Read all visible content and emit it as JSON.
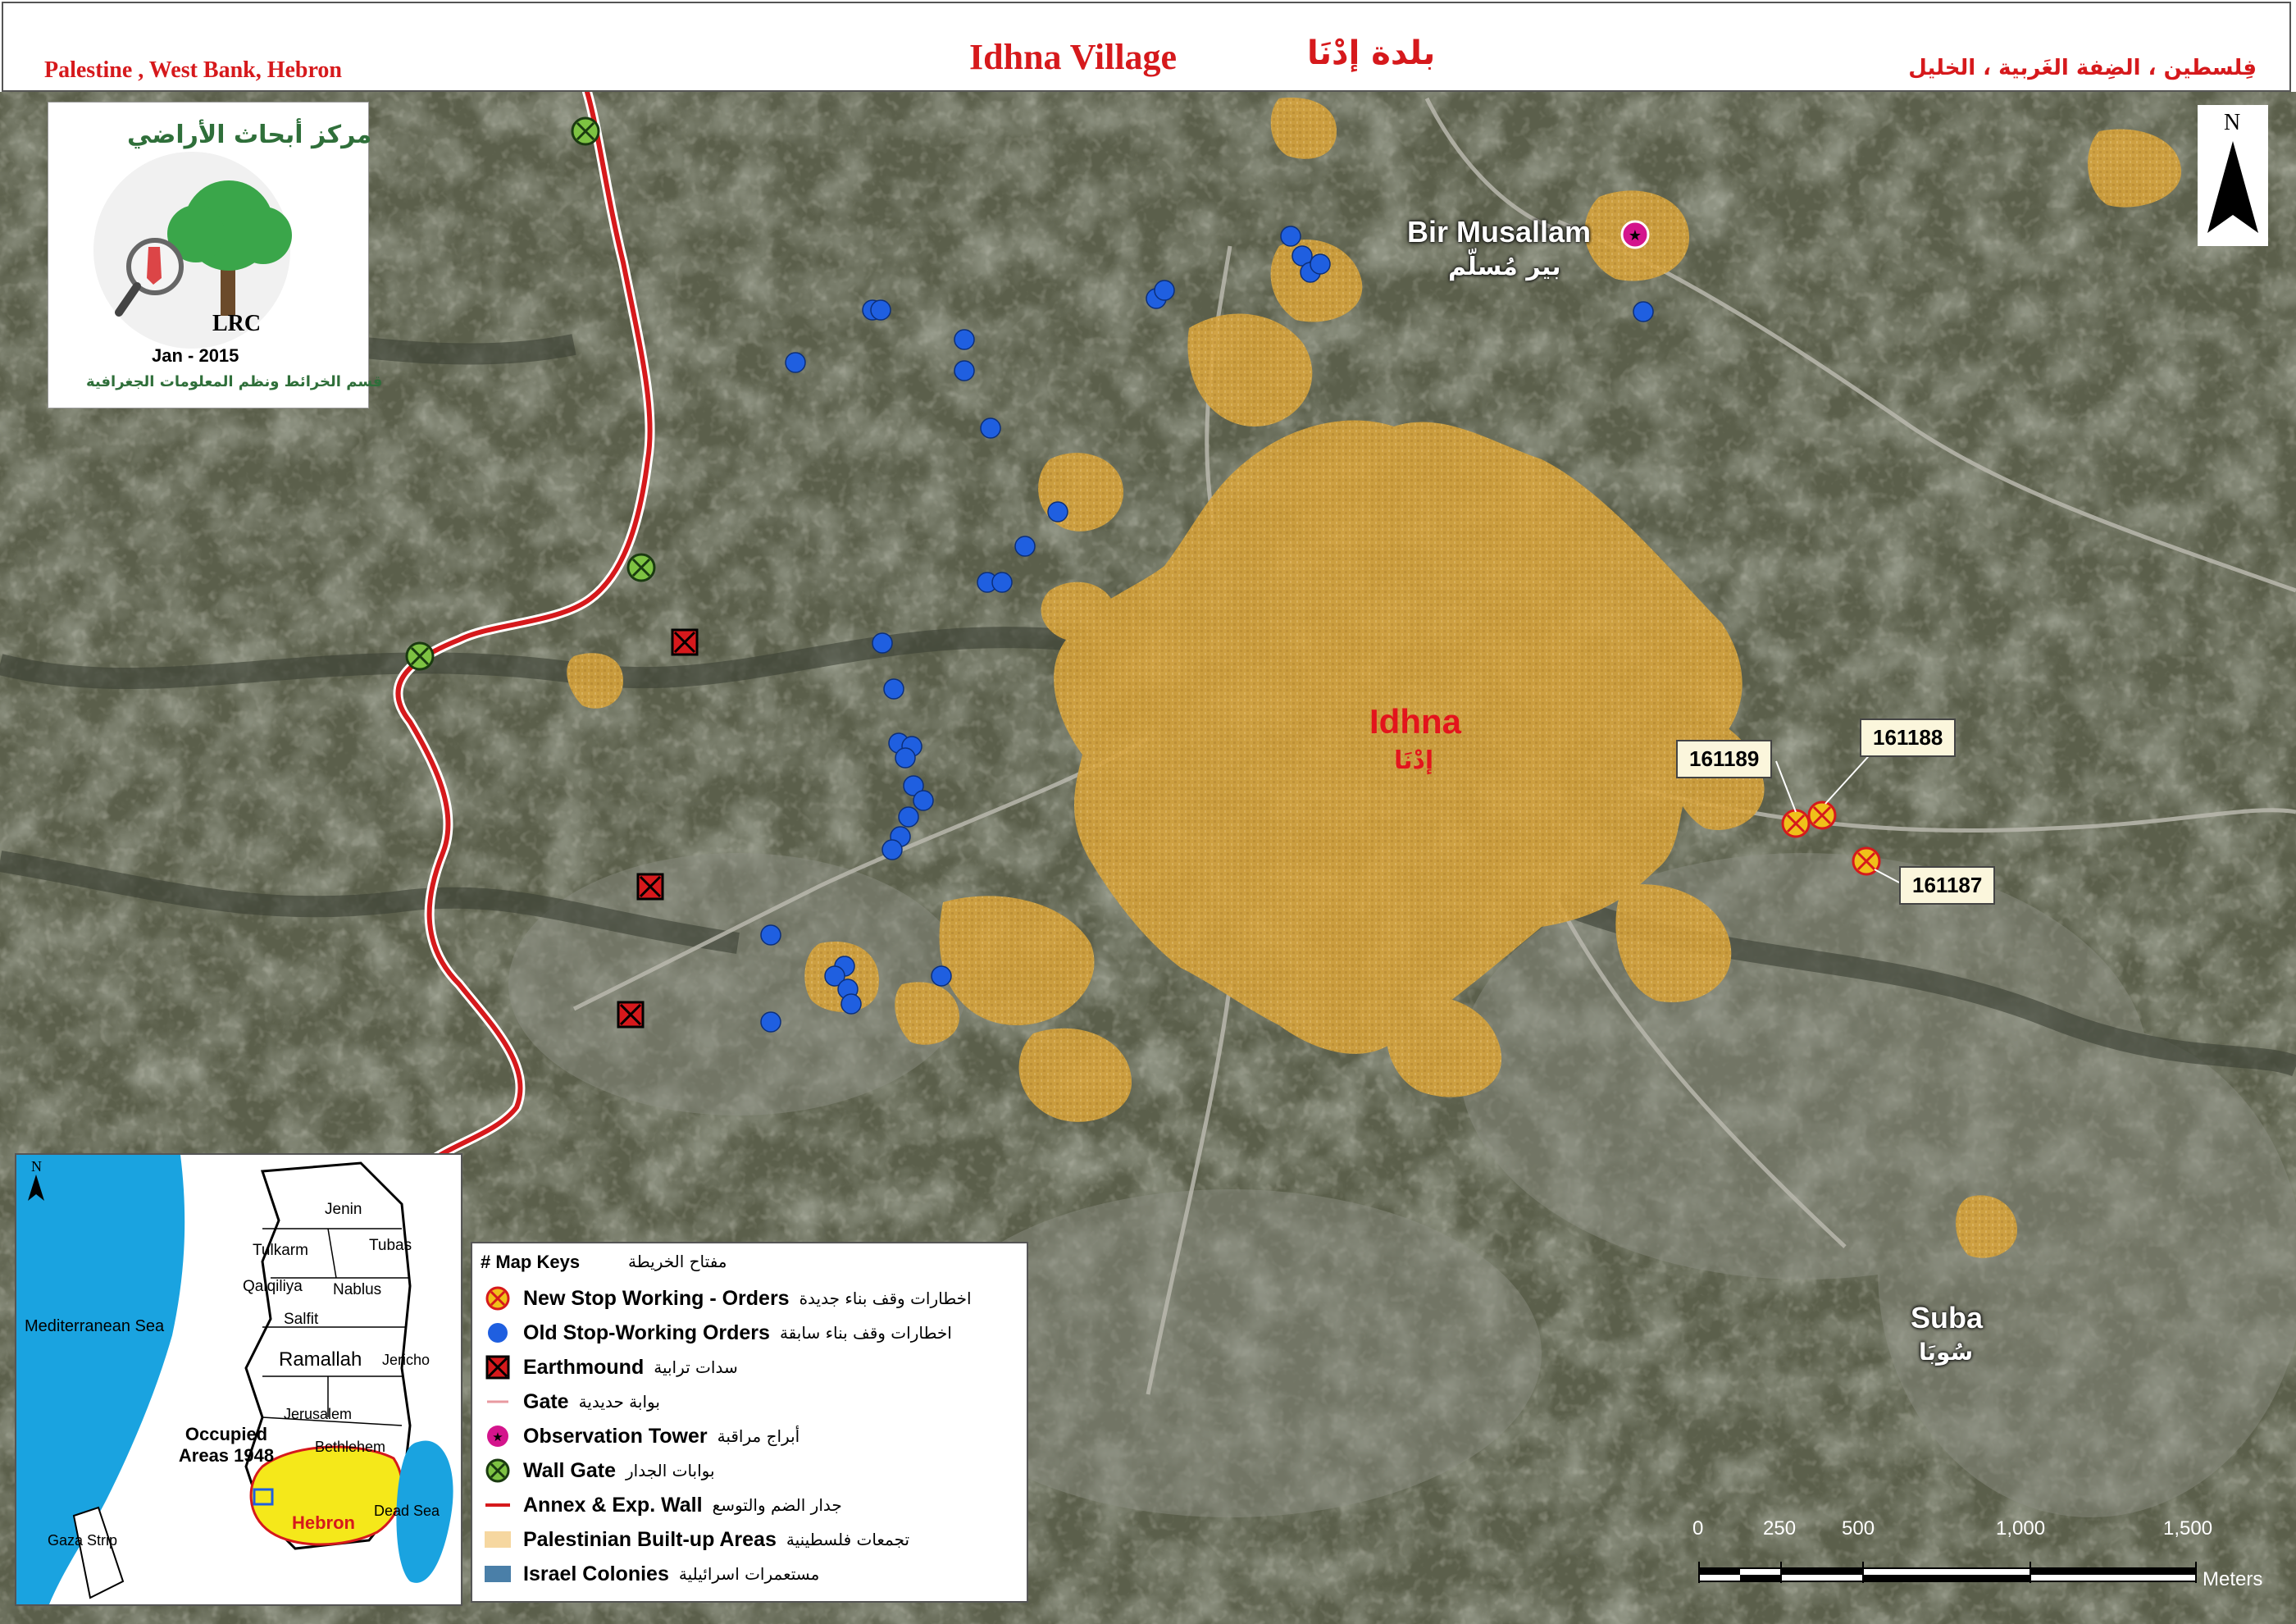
{
  "header": {
    "left": "Palestine , West Bank, Hebron",
    "title_en": "Idhna Village",
    "title_ar": "بلدة إدْنَا",
    "right_ar": "فِلسطين ، الضِفة الغَربية ، الخليل"
  },
  "logo": {
    "arc_text_ar": "مركز أبحاث الأراضي",
    "org": "LRC",
    "date": "Jan - 2015",
    "dept_ar": "قسم الخرائط ونظم المعلومات الجغرافية"
  },
  "places": {
    "idhna_en": "Idhna",
    "idhna_ar": "إدْنَا",
    "bir_en": "Bir Musallam",
    "bir_ar": "بير مُسلّم",
    "suba_en": "Suba",
    "suba_ar": "سُوبَا"
  },
  "callouts": [
    "161189",
    "161188",
    "161187"
  ],
  "north": "N",
  "inset": {
    "north": "N",
    "sea": "Mediterranean Sea",
    "dead_sea": "Dead Sea",
    "gaza": "Gaza Strip",
    "occupied": "Occupied Areas 1948",
    "hebron": "Hebron",
    "jenin": "Jenin",
    "tubas": "Tubas",
    "tulkarm": "Tulkarm",
    "qalqiliya": "Qalqiliya",
    "nablus": "Nablus",
    "salfit": "Salfit",
    "ramallah": "Ramallah",
    "jericho": "Jericho",
    "jerusalem": "Jerusalem",
    "bethlehem": "Bethlehem"
  },
  "legend": {
    "title_en": "# Map Keys",
    "title_ar": "مفتاح الخريطة",
    "items": [
      {
        "en": "New Stop Working - Orders",
        "ar": "اخطارات وقف بناء جديدة",
        "symbol": "new-order-icon"
      },
      {
        "en": "Old Stop-Working Orders",
        "ar": "اخطارات وقف بناء سابقة",
        "symbol": "old-order-icon"
      },
      {
        "en": "Earthmound",
        "ar": "سدات ترابية",
        "symbol": "earthmound-icon"
      },
      {
        "en": "Gate",
        "ar": "بوابة حديدية",
        "symbol": "gate-icon"
      },
      {
        "en": "Observation Tower",
        "ar": "أبراج مراقبة",
        "symbol": "tower-icon"
      },
      {
        "en": "Wall Gate",
        "ar": "بوابات الجدار",
        "symbol": "wall-gate-icon"
      },
      {
        "en": "Annex & Exp. Wall",
        "ar": "جدار الضم والتوسع",
        "symbol": "wall-line-icon"
      },
      {
        "en": "Palestinian Built-up Areas",
        "ar": "تجمعات فلسطينية",
        "symbol": "builtup-swatch"
      },
      {
        "en": "Israel Colonies",
        "ar": "مستعمرات اسرائيلية",
        "symbol": "colony-swatch"
      }
    ]
  },
  "scale": {
    "ticks": [
      "0",
      "250",
      "500",
      "1,000",
      "1,500"
    ],
    "unit": "Meters"
  },
  "colors": {
    "builtup": "#d6a33c",
    "old_order": "#1f5fe0",
    "new_order": "#f0c01a",
    "wall": "#d6191c",
    "wall_gate": "#7dc242",
    "tower": "#d4148c",
    "colony": "#4a7fa8",
    "satellite": "#5a5e4a"
  }
}
